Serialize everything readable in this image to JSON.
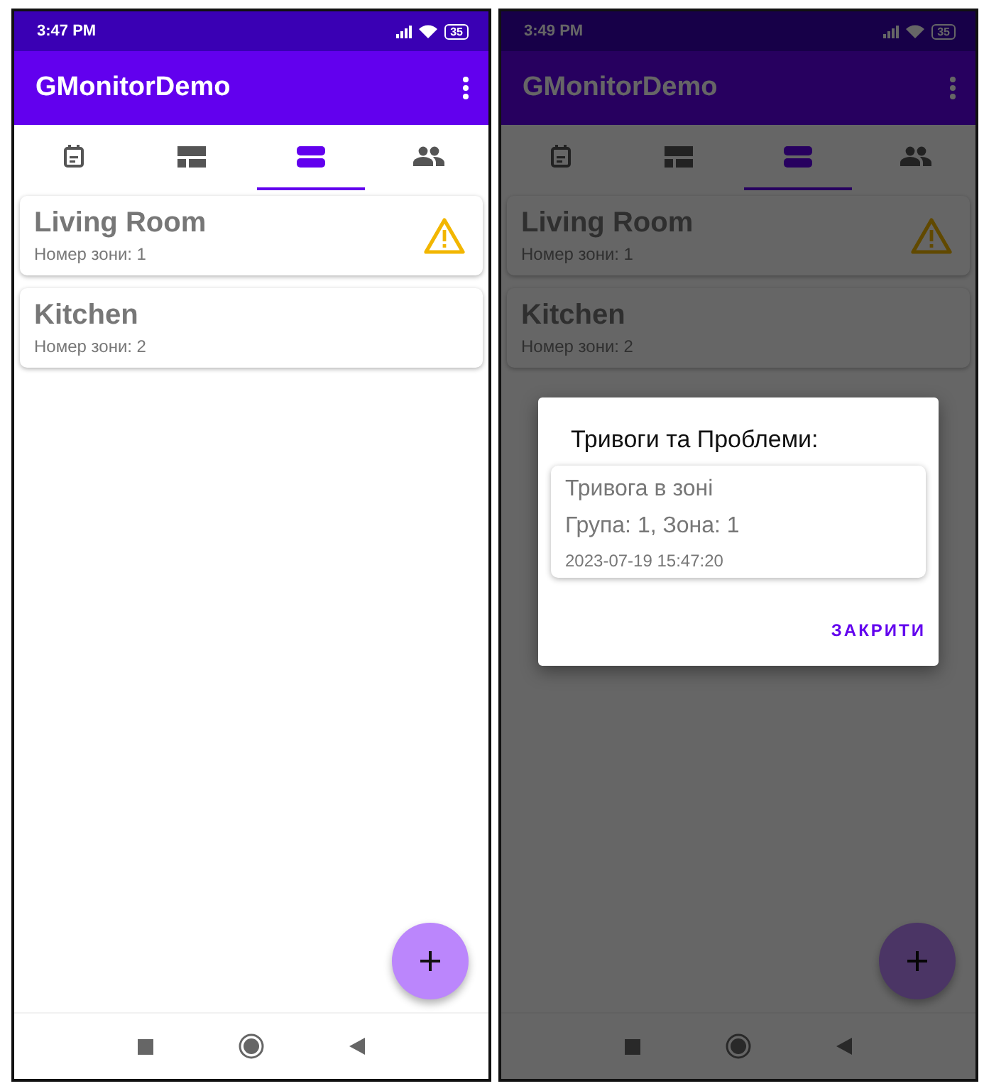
{
  "screens": [
    {
      "status_bar": {
        "time": "3:47 PM",
        "battery": "35"
      },
      "app_bar": {
        "title": "GMonitorDemo"
      },
      "tabs": [
        {
          "kind": "calendar",
          "selected": false
        },
        {
          "kind": "dashboard",
          "selected": false
        },
        {
          "kind": "zones",
          "selected": true
        },
        {
          "kind": "people",
          "selected": false
        }
      ],
      "zones": [
        {
          "name": "Living Room",
          "number": "Номер зони: 1",
          "alarm": true
        },
        {
          "name": "Kitchen",
          "number": "Номер зони: 2",
          "alarm": false
        }
      ]
    },
    {
      "status_bar": {
        "time": "3:49 PM",
        "battery": "35"
      },
      "app_bar": {
        "title": "GMonitorDemo"
      },
      "tabs": [
        {
          "kind": "calendar",
          "selected": false
        },
        {
          "kind": "dashboard",
          "selected": false
        },
        {
          "kind": "zones",
          "selected": true
        },
        {
          "kind": "people",
          "selected": false
        }
      ],
      "zones": [
        {
          "name": "Living Room",
          "number": "Номер зони: 1",
          "alarm": true
        },
        {
          "name": "Kitchen",
          "number": "Номер зони: 2",
          "alarm": false
        }
      ],
      "dialog": {
        "title": "Тривоги та Проблеми:",
        "alerts": [
          {
            "title": "Тривога в зоні",
            "detail": "Група: 1, Зона: 1",
            "time": "2023-07-19 15:47:20"
          }
        ],
        "button": "ЗАКРИТИ"
      }
    }
  ]
}
